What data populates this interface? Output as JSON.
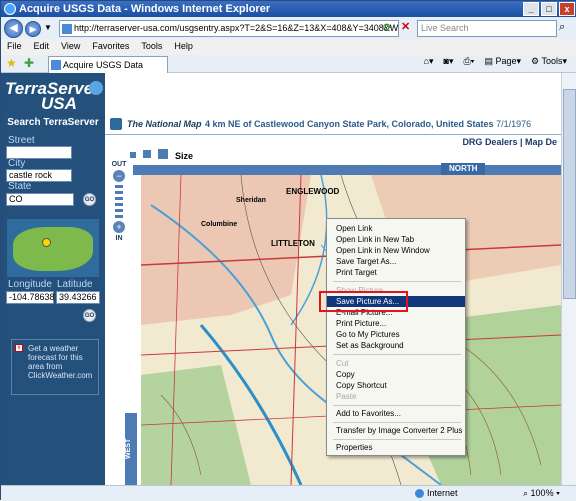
{
  "window": {
    "title": "Acquire USGS Data - Windows Internet Explorer",
    "buttons": [
      "_",
      "□",
      "x"
    ]
  },
  "address_bar": {
    "url": "http://terraserver-usa.com/usgsentry.aspx?T=2&S=16&Z=13&X=408&Y=3408&W=3&qs=%7c",
    "search_placeholder": "Live Search"
  },
  "menu": [
    "File",
    "Edit",
    "View",
    "Favorites",
    "Tools",
    "Help"
  ],
  "tab": {
    "label": "Acquire USGS Data"
  },
  "command_bar": {
    "page": "Page",
    "tools": "Tools"
  },
  "sidebar": {
    "logo_line1": "TerraServer",
    "logo_line2": "USA",
    "search_title": "Search TerraServer",
    "street_label": "Street",
    "street_value": "",
    "city_label": "City",
    "city_value": "castle rock",
    "state_label": "State",
    "state_value": "CO",
    "go_label": "GO",
    "longitude_label": "Longitude",
    "latitude_label": "Latitude",
    "longitude_value": "-104.78638",
    "latitude_value": "39.43266",
    "weather_text": "Get a weather forecast for this area from ClickWeather.com"
  },
  "main": {
    "national_map": "The National Map",
    "location": "4 km NE of Castlewood Canyon State Park, Colorado, United States",
    "date": "7/1/1976",
    "links": "DRG Dealers | Map De",
    "size_label": "Size",
    "north_label": "NORTH",
    "west_label": "WEST",
    "zoom_out": "OUT",
    "zoom_in": "IN",
    "map_labels": {
      "englewood": "ENGLEWOOD",
      "littleton": "LITTLETON",
      "sheridan": "Sheridan",
      "columbine": "Columbine"
    }
  },
  "context_menu": {
    "items": [
      {
        "label": "Open Link",
        "state": "normal"
      },
      {
        "label": "Open Link in New Tab",
        "state": "normal"
      },
      {
        "label": "Open Link in New Window",
        "state": "normal"
      },
      {
        "label": "Save Target As...",
        "state": "normal"
      },
      {
        "label": "Print Target",
        "state": "normal"
      },
      {
        "label": "Show Picture",
        "state": "disabled"
      },
      {
        "label": "Save Picture As...",
        "state": "selected"
      },
      {
        "label": "E-mail Picture...",
        "state": "normal"
      },
      {
        "label": "Print Picture...",
        "state": "normal"
      },
      {
        "label": "Go to My Pictures",
        "state": "normal"
      },
      {
        "label": "Set as Background",
        "state": "normal"
      },
      {
        "label": "Cut",
        "state": "disabled"
      },
      {
        "label": "Copy",
        "state": "normal"
      },
      {
        "label": "Copy Shortcut",
        "state": "normal"
      },
      {
        "label": "Paste",
        "state": "disabled"
      },
      {
        "label": "Add to Favorites...",
        "state": "normal"
      },
      {
        "label": "Transfer by Image Converter 2 Plus",
        "state": "normal"
      },
      {
        "label": "Properties",
        "state": "normal"
      }
    ]
  },
  "status_bar": {
    "zone": "Internet",
    "zoom": "100%"
  },
  "colors": {
    "sidebar": "#24507c",
    "menu_highlight": "#11367a",
    "callout_box": "#e4141c",
    "accent_blue": "#4f7bb4"
  }
}
